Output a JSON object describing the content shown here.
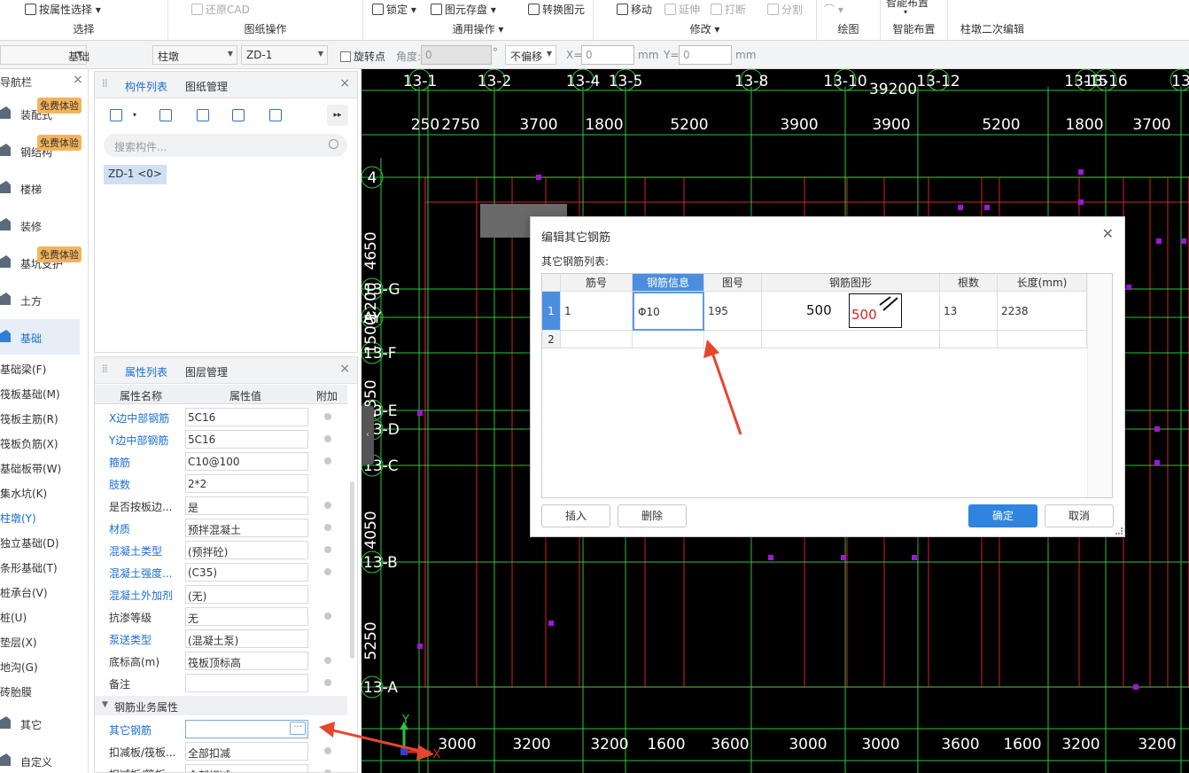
{
  "ribbon": {
    "groups": [
      {
        "label": "选择",
        "items": [
          "按属性选择"
        ]
      },
      {
        "label": "图纸操作",
        "items": [
          "还原CAD"
        ]
      },
      {
        "label": "通用操作",
        "items": [
          "锁定",
          "图元存盘",
          "转换图元"
        ]
      },
      {
        "label": "修改",
        "items": [
          "移动",
          "延伸",
          "打断",
          "分割"
        ]
      },
      {
        "label": "绘图",
        "items": []
      },
      {
        "label": "智能布置",
        "items": [
          "智能布置"
        ]
      },
      {
        "label": "柱墩二次编辑",
        "items": []
      }
    ]
  },
  "toolbar": {
    "combos": [
      "基础",
      "柱墩",
      "ZD-1",
      "不偏移"
    ],
    "rotate_label": "旋转点",
    "angle_label": "角度:",
    "angle_value": "0",
    "x_label": "X=",
    "x_value": "0",
    "y_label": "Y=",
    "y_value": "0",
    "unit": "mm",
    "degree": "°"
  },
  "navbar": {
    "title": "导航栏",
    "items": [
      {
        "label": "装配式",
        "badge": "免费体验"
      },
      {
        "label": "钢结构",
        "badge": "免费体验"
      },
      {
        "label": "楼梯",
        "badge": ""
      },
      {
        "label": "装修",
        "badge": ""
      },
      {
        "label": "基坑支护",
        "badge": "免费体验"
      },
      {
        "label": "土方",
        "badge": ""
      },
      {
        "label": "基础",
        "badge": ""
      }
    ],
    "sub_items": [
      "基础梁(F)",
      "筏板基础(M)",
      "筏板主筋(R)",
      "筏板负筋(X)",
      "基础板带(W)",
      "集水坑(K)",
      "柱墩(Y)",
      "独立基础(D)",
      "条形基础(T)",
      "桩承台(V)",
      "桩(U)",
      "垫层(X)",
      "地沟(G)",
      "砖胎膜"
    ],
    "active_sub": "柱墩(Y)",
    "bottom_items": [
      "其它",
      "自定义"
    ]
  },
  "component_panel": {
    "tabs": [
      "构件列表",
      "图纸管理"
    ],
    "search_placeholder": "搜索构件...",
    "selected_item": "ZD-1 <0>"
  },
  "property_panel": {
    "tabs": [
      "属性列表",
      "图层管理"
    ],
    "headers": [
      "属性名称",
      "属性值",
      "附加"
    ],
    "rows": [
      {
        "name": "X边中部钢筋",
        "value": "5C16",
        "blue": true,
        "dot": true
      },
      {
        "name": "Y边中部钢筋",
        "value": "5C16",
        "blue": true,
        "dot": true
      },
      {
        "name": "箍筋",
        "value": "C10@100",
        "blue": true,
        "dot": true
      },
      {
        "name": "肢数",
        "value": "2*2",
        "blue": true,
        "dot": false
      },
      {
        "name": "是否按板边...",
        "value": "是",
        "blue": false,
        "dot": true
      },
      {
        "name": "材质",
        "value": "预拌混凝土",
        "blue": true,
        "dot": true
      },
      {
        "name": "混凝土类型",
        "value": "(预拌砼)",
        "blue": true,
        "dot": true
      },
      {
        "name": "混凝土强度...",
        "value": "(C35)",
        "blue": true,
        "dot": true
      },
      {
        "name": "混凝土外加剂",
        "value": "(无)",
        "blue": true,
        "dot": false
      },
      {
        "name": "抗渗等级",
        "value": "无",
        "blue": false,
        "dot": true
      },
      {
        "name": "泵送类型",
        "value": "(混凝土泵)",
        "blue": true,
        "dot": false
      },
      {
        "name": "底标高(m)",
        "value": "筏板顶标高",
        "blue": false,
        "dot": true
      },
      {
        "name": "备注",
        "value": "",
        "blue": false,
        "dot": true
      }
    ],
    "section": "钢筋业务属性",
    "rebar_rows": [
      {
        "name": "其它钢筋",
        "value": "",
        "blue": true,
        "dot": false
      },
      {
        "name": "扣减板/筏板...",
        "value": "全部扣减",
        "blue": false,
        "dot": true
      },
      {
        "name": "扣减板/筏板...",
        "value": "全部扣减",
        "blue": false,
        "dot": true
      }
    ],
    "ellipsis": "···"
  },
  "cad": {
    "top_axes": [
      "13-1",
      "13-2",
      "13-4",
      "13-5",
      "13-8",
      "13-10",
      "13-12",
      "13-15",
      "13-16",
      "13"
    ],
    "top_total": "39200",
    "top_dims": [
      "250",
      "2750",
      "3700",
      "1800",
      "5200",
      "3900",
      "3900",
      "5200",
      "1800",
      "3700"
    ],
    "left_axes": [
      "4",
      "13-G",
      "AY",
      "13-F",
      "13-E",
      "13-D",
      "13-C",
      "13-B",
      "13-A"
    ],
    "left_dims": [
      "4650",
      "1200",
      "1500",
      "2350",
      "4050",
      "5250"
    ],
    "bottom_dims": [
      "3000",
      "3200",
      "3200",
      "1600",
      "3600",
      "3000",
      "3000",
      "3600",
      "1600",
      "3200",
      "3200"
    ],
    "axis_x": "X",
    "axis_y": "Y"
  },
  "dialog": {
    "title": "编辑其它钢筋",
    "subtitle": "其它钢筋列表:",
    "headers": [
      "筋号",
      "钢筋信息",
      "图号",
      "钢筋图形",
      "根数",
      "长度(mm)"
    ],
    "rows": [
      {
        "num": "1",
        "jinhao": "1",
        "info": "Φ10",
        "tuhao": "195",
        "shape_a": "500",
        "shape_b": "500",
        "count": "13",
        "length": "2238"
      },
      {
        "num": "2",
        "jinhao": "",
        "info": "",
        "tuhao": "",
        "shape_a": "",
        "shape_b": "",
        "count": "",
        "length": ""
      }
    ],
    "buttons": {
      "insert": "插入",
      "delete": "删除",
      "ok": "确定",
      "cancel": "取消"
    }
  },
  "colors": {
    "accent": "#2f84e0",
    "grid_red": "#d8202c",
    "grid_green": "#2ec43a",
    "annotation": "#e8452f",
    "marker": "#9c19d6"
  }
}
